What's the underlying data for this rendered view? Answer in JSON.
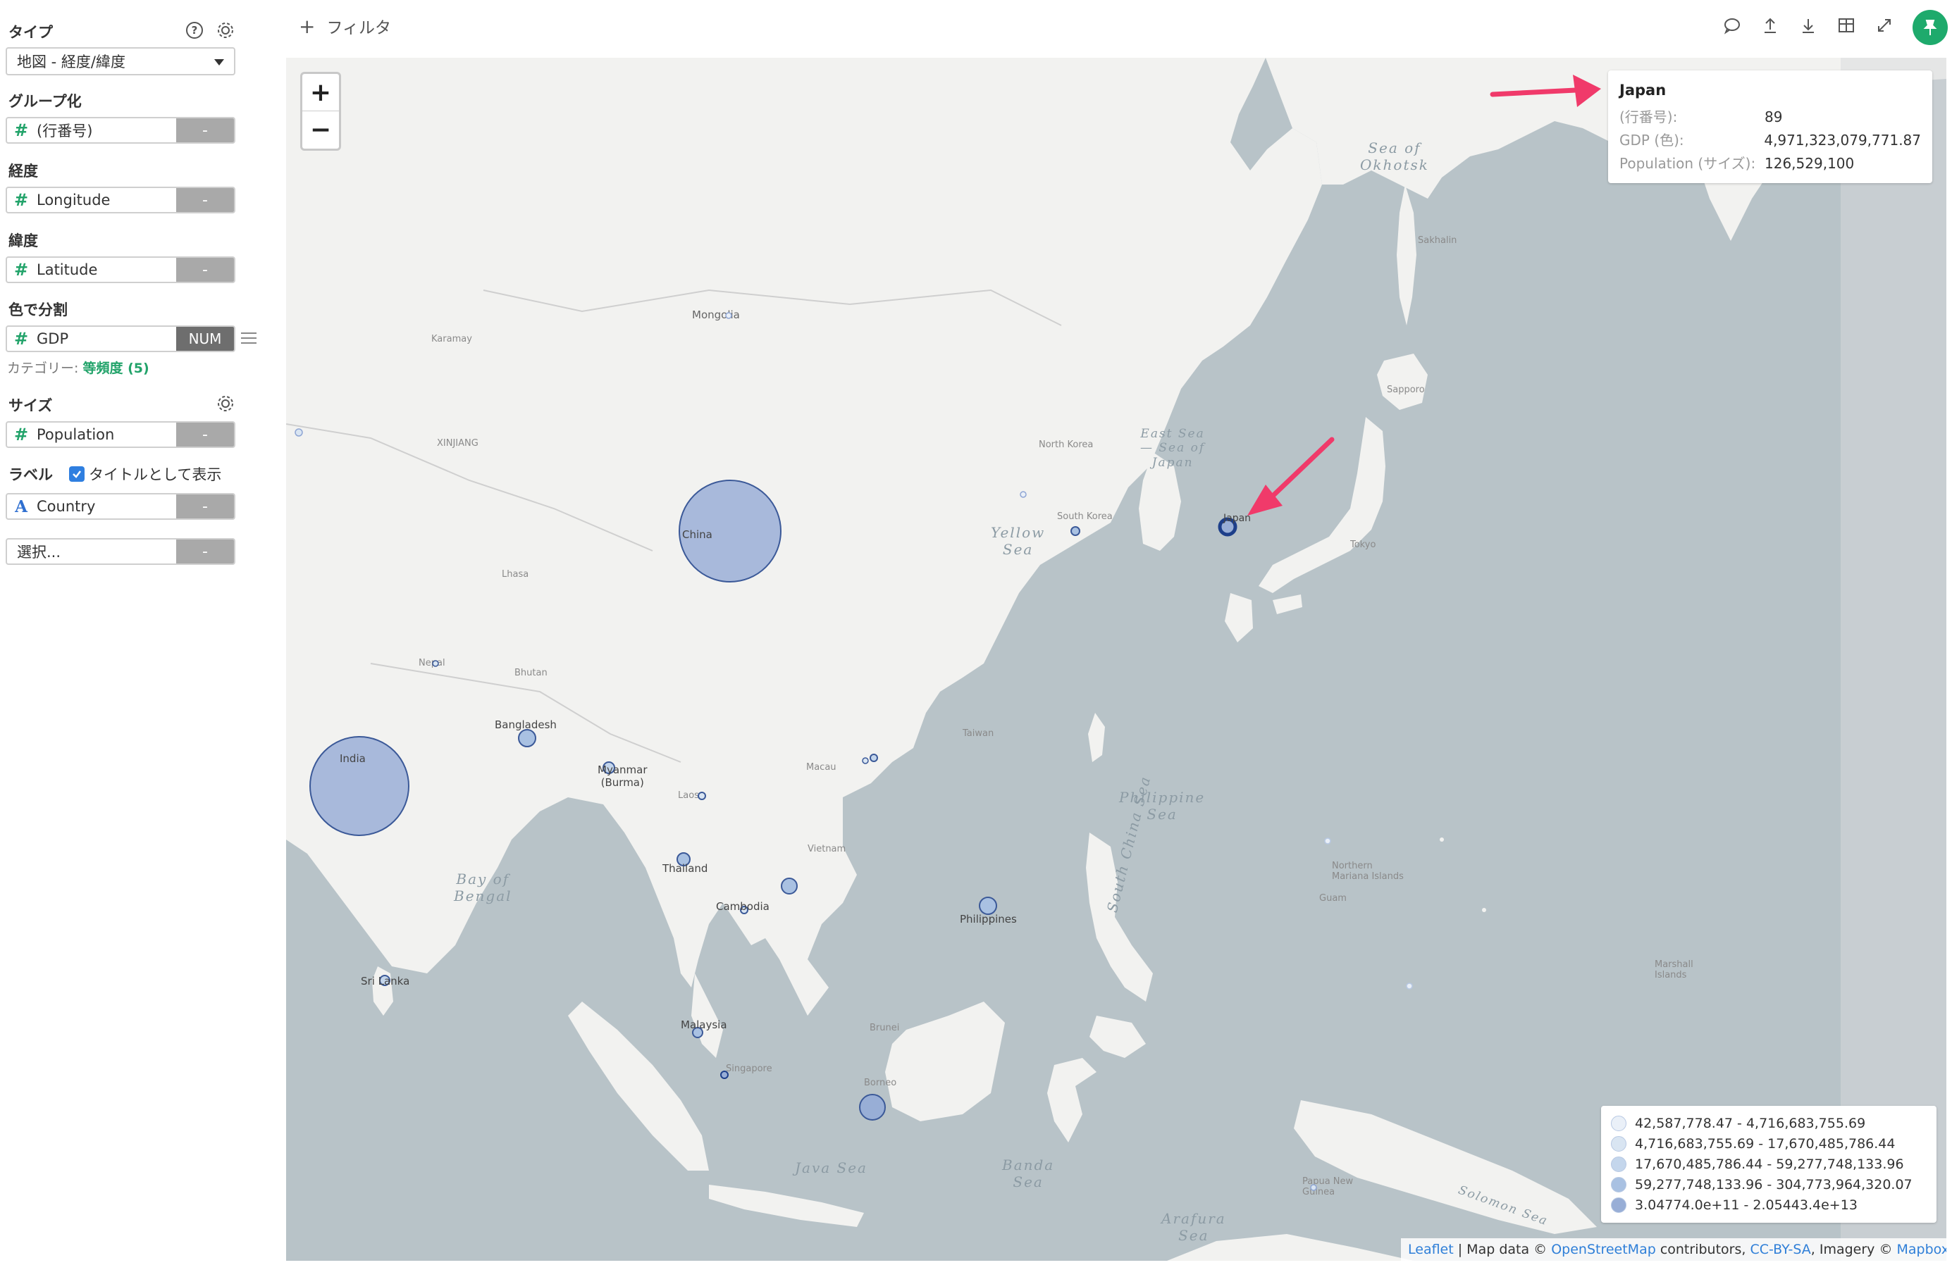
{
  "sidebar": {
    "type": {
      "label": "タイプ",
      "value": "地図 - 経度/緯度"
    },
    "group": {
      "label": "グループ化",
      "field": "(行番号)",
      "button": "-"
    },
    "longitude": {
      "label": "経度",
      "field": "Longitude",
      "button": "-"
    },
    "latitude": {
      "label": "緯度",
      "field": "Latitude",
      "button": "-"
    },
    "color": {
      "label": "色で分割",
      "field": "GDP",
      "button": "NUM",
      "category_prefix": "カテゴリー: ",
      "category_value": "等頻度 (5)"
    },
    "size": {
      "label": "サイズ",
      "field": "Population",
      "button": "-"
    },
    "label_section": {
      "label": "ラベル",
      "checkbox_label": "タイトルとして表示",
      "checked": true,
      "field": "Country",
      "button": "-"
    },
    "extra_select": {
      "placeholder": "選択...",
      "button": "-"
    }
  },
  "toolbar": {
    "filter_label": "フィルタ",
    "icons": [
      "comment-icon",
      "upload-icon",
      "download-icon",
      "table-icon",
      "expand-icon",
      "pin-icon"
    ]
  },
  "map": {
    "zoom_in": "+",
    "zoom_out": "−",
    "seas": {
      "okhotsk": "Sea of\nOkhotsk",
      "east_sea": "East Sea\n— Sea of\nJapan",
      "yellow": "Yellow\nSea",
      "philippine": "Philippine\nSea",
      "bengal": "Bay of\nBengal",
      "south_china": "South China Sea",
      "java": "Java Sea",
      "banda": "Banda\nSea",
      "arafura": "Arafura\nSea",
      "solomon": "Solomon Sea"
    },
    "places": {
      "mongolia": "Mongolia",
      "north_korea": "North Korea",
      "south_korea": "South Korea",
      "taiwan": "Taiwan",
      "nepal": "Nepal",
      "bhutan": "Bhutan",
      "macau": "Macau",
      "laos": "Laos",
      "vietnam": "Vietnam",
      "borneo": "Borneo",
      "brunei": "Brunei",
      "singapore": "Singapore",
      "papua": "Papua New\nGuinea",
      "northern_mariana": "Northern\nMariana Islands",
      "guam": "Guam",
      "marshall": "Marshall\nIslands",
      "sakhalin": "Sakhalin",
      "sapporo": "Sapporo",
      "tokyo": "Tokyo",
      "kazakhstan": "Karamay",
      "xinjiang": "XINJIANG",
      "tibet": "Lhasa"
    },
    "bubble_labels": {
      "china": "China",
      "india": "India",
      "japan": "Japan",
      "bangladesh": "Bangladesh",
      "myanmar": "Myanmar\n(Burma)",
      "thailand": "Thailand",
      "cambodia": "Cambodia",
      "philippines": "Philippines",
      "malaysia": "Malaysia",
      "sri_lanka": "Sri Lanka"
    },
    "tooltip": {
      "title": "Japan",
      "rows": [
        {
          "key": "(行番号):",
          "value": "89"
        },
        {
          "key": "GDP (色):",
          "value": "4,971,323,079,771.87"
        },
        {
          "key": "Population (サイズ):",
          "value": "126,529,100"
        }
      ]
    },
    "legend": [
      {
        "label": "42,587,778.47 - 4,716,683,755.69",
        "color": "#eaf0f8"
      },
      {
        "label": "4,716,683,755.69 - 17,670,485,786.44",
        "color": "#d9e5f2"
      },
      {
        "label": "17,670,485,786.44 - 59,277,748,133.96",
        "color": "#c4d6ec"
      },
      {
        "label": "59,277,748,133.96 - 304,773,964,320.07",
        "color": "#a9c1e2"
      },
      {
        "label": "3.04774.0e+11 - 2.05443.4e+13",
        "color": "#98aed6"
      }
    ],
    "attribution": {
      "leaflet": "Leaflet",
      "sep1": " | Map data © ",
      "osm": "OpenStreetMap",
      "sep2": " contributors, ",
      "license": "CC-BY-SA",
      "sep3": ", Imagery © ",
      "mapbox": "Mapbox"
    },
    "colors": {
      "land": "#f2f2f0",
      "sea": "#b8c3c8",
      "bubble_fill": "#8fa6d4",
      "bubble_stroke": "#3b5998",
      "arrow": "#f03a6a"
    }
  }
}
